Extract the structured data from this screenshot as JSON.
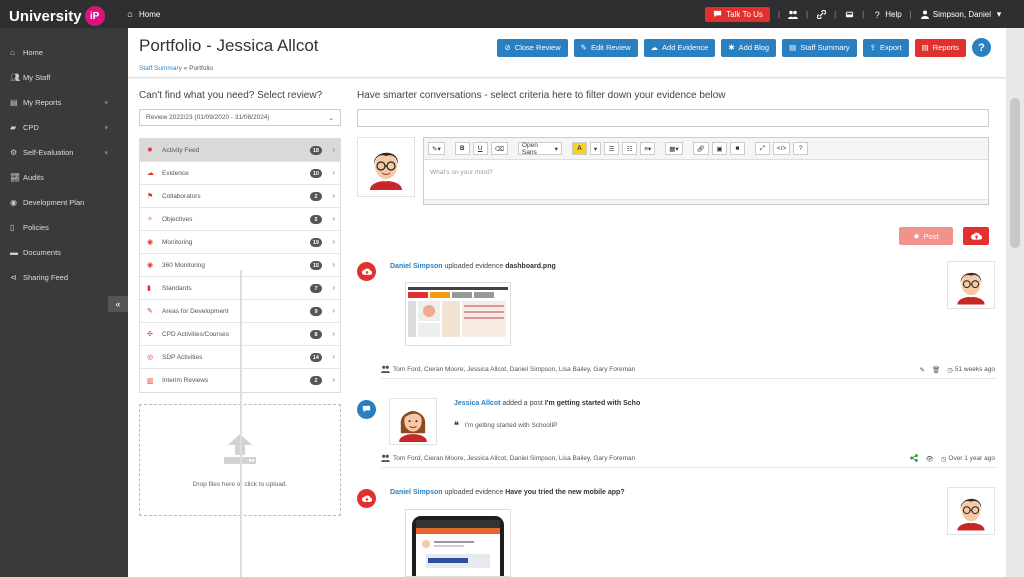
{
  "topbar": {
    "logo_text": "University",
    "logo_badge": "iP",
    "home_label": "Home",
    "talk_label": "Talk To Us",
    "help_label": "Help",
    "user_label": "Simpson, Daniel"
  },
  "sidebar": {
    "items": [
      {
        "label": "Home",
        "icon": "home-icon",
        "chev": false
      },
      {
        "label": "My Staff",
        "icon": "users-icon",
        "chev": false
      },
      {
        "label": "My Reports",
        "icon": "reports-icon",
        "chev": true
      },
      {
        "label": "CPD",
        "icon": "cpd-icon",
        "chev": true
      },
      {
        "label": "Self-Evaluation",
        "icon": "gear-icon",
        "chev": true
      },
      {
        "label": "Audits",
        "icon": "chart-icon",
        "chev": false
      },
      {
        "label": "Development Plan",
        "icon": "globe-icon",
        "chev": false
      },
      {
        "label": "Policies",
        "icon": "document-icon",
        "chev": false
      },
      {
        "label": "Documents",
        "icon": "folder-icon",
        "chev": false
      },
      {
        "label": "Sharing Feed",
        "icon": "share-icon",
        "chev": false
      }
    ],
    "collapse_glyph": "«"
  },
  "header": {
    "title": "Portfolio - Jessica Allcot",
    "breadcrumb_link": "Staff Summary",
    "breadcrumb_sep": " » ",
    "breadcrumb_current": "Portfolio",
    "buttons": [
      {
        "label": "Close Review",
        "color": "blue"
      },
      {
        "label": "Edit Review",
        "color": "blue"
      },
      {
        "label": "Add Evidence",
        "color": "blue"
      },
      {
        "label": "Add Blog",
        "color": "blue"
      },
      {
        "label": "Staff Summary",
        "color": "blue"
      },
      {
        "label": "Export",
        "color": "blue"
      },
      {
        "label": "Reports",
        "color": "red"
      }
    ],
    "help_glyph": "?"
  },
  "left": {
    "heading": "Can't find what you need? Select review?",
    "select_value": "Review 2022/23 (01/09/2020 - 31/08/2024)",
    "menu": [
      {
        "label": "Activity Feed",
        "count": "18",
        "active": true
      },
      {
        "label": "Evidence",
        "count": "10",
        "active": false
      },
      {
        "label": "Collaborators",
        "count": "2",
        "active": false
      },
      {
        "label": "Objectives",
        "count": "5",
        "active": false
      },
      {
        "label": "Monitoring",
        "count": "19",
        "active": false
      },
      {
        "label": "360 Monitoring",
        "count": "15",
        "active": false
      },
      {
        "label": "Standards",
        "count": "7",
        "active": false
      },
      {
        "label": "Areas for Development",
        "count": "9",
        "active": false
      },
      {
        "label": "CPD Activities/Courses",
        "count": "8",
        "active": false
      },
      {
        "label": "SDP Activities",
        "count": "14",
        "active": false
      },
      {
        "label": "Interim Reviews",
        "count": "2",
        "active": false
      }
    ],
    "dropzone_text": "Drop files here or click to upload."
  },
  "right": {
    "heading": "Have smarter conversations - select criteria here to filter down your evidence below",
    "editor_placeholder": "What's on your mind?",
    "font_select": "Open Sans",
    "post_label": "Post"
  },
  "feed": [
    {
      "author": "Daniel Simpson",
      "action": "uploaded evidence",
      "subject": "dashboard.png",
      "people": "Tom Ford, Cieran Moore, Jessica Allcot, Daniel Simpson, Lisa Bailey, Gary Foreman",
      "time": "51 weeks ago"
    },
    {
      "author": "Jessica Allcot",
      "action": "added a post",
      "subject": "I'm getting started with Scho",
      "quote": "I'm getting started with SchoolIP",
      "people": "Tom Ford, Cieran Moore, Jessica Allcot, Daniel Simpson, Lisa Bailey, Gary Foreman",
      "time": "Over 1 year ago"
    },
    {
      "author": "Daniel Simpson",
      "action": "uploaded evidence",
      "subject": "Have you tried the new mobile app?"
    }
  ],
  "colors": {
    "accent_blue": "#2a7fc0",
    "accent_red": "#e0312f",
    "brand_pink": "#d9147c"
  }
}
